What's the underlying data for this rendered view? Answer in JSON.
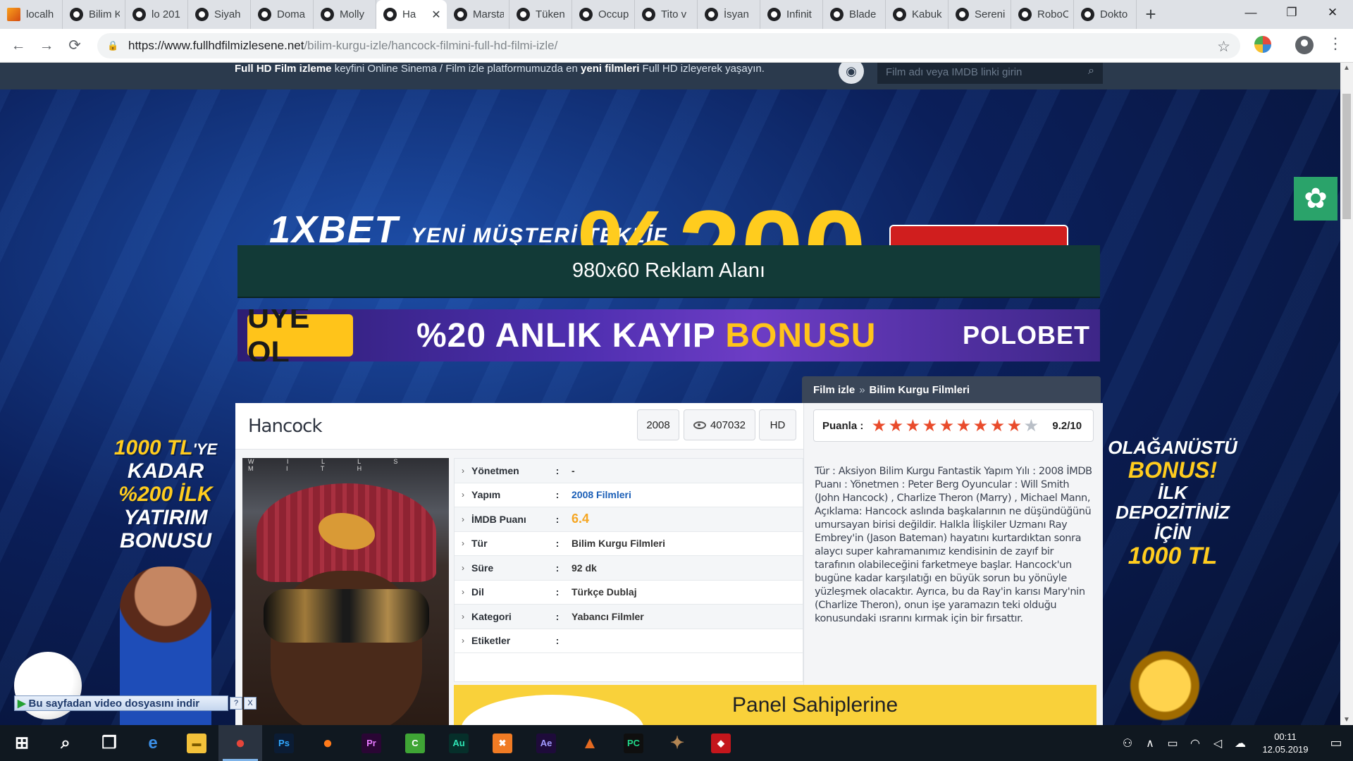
{
  "browser": {
    "tabs": [
      {
        "label": "localh",
        "icon": "phpmyadmin-icon"
      },
      {
        "label": "Bilim K",
        "icon": "film-reel-icon"
      },
      {
        "label": "lo 201",
        "icon": "film-reel-icon"
      },
      {
        "label": "Siyah",
        "icon": "film-reel-icon"
      },
      {
        "label": "Doma",
        "icon": "film-reel-icon"
      },
      {
        "label": "Molly",
        "icon": "film-reel-icon"
      },
      {
        "label": "Ha",
        "icon": "film-reel-icon",
        "active": true
      },
      {
        "label": "Marsta",
        "icon": "film-reel-icon"
      },
      {
        "label": "Tüken",
        "icon": "film-reel-icon"
      },
      {
        "label": "Occup",
        "icon": "film-reel-icon"
      },
      {
        "label": "Tito v",
        "icon": "film-reel-icon"
      },
      {
        "label": "İsyan",
        "icon": "film-reel-icon"
      },
      {
        "label": "Infinit",
        "icon": "film-reel-icon"
      },
      {
        "label": "Blade",
        "icon": "film-reel-icon"
      },
      {
        "label": "Kabuk",
        "icon": "film-reel-icon"
      },
      {
        "label": "Sereni",
        "icon": "film-reel-icon"
      },
      {
        "label": "RoboC",
        "icon": "film-reel-icon"
      },
      {
        "label": "Dokto",
        "icon": "film-reel-icon"
      }
    ],
    "new_tab": "+",
    "window_controls": {
      "minimize": "—",
      "maximize": "❐",
      "close": "✕"
    },
    "nav": {
      "back": "←",
      "forward": "→",
      "reload": "⟳"
    },
    "url_host": "https://www.fullhdfilmizlesene.net",
    "url_path": "/bilim-kurgu-izle/hancock-filmini-full-hd-filmi-izle/",
    "bookmark_star": "☆",
    "menu": "⋮"
  },
  "site": {
    "tagline_parts": [
      {
        "text": "Full HD Film izleme",
        "bold": true
      },
      {
        "text": " keyfini Online Sinema / Film izle platformumuzda en ",
        "bold": false
      },
      {
        "text": "yeni filmleri",
        "bold": true
      },
      {
        "text": " Full HD izleyerek yaşayın.",
        "bold": false
      }
    ],
    "search_placeholder": "Film adı veya IMDB linki girin",
    "rss_icon": "rss-icon"
  },
  "ads": {
    "bg_brand": "1XBET",
    "bg_text": "YENİ MÜŞTERİ TEKLİF",
    "bg_number": "%200",
    "reklam_label": "980x60 Reklam Alanı",
    "polo_uye": "ÜYE OL",
    "polo_text_white": "%20 ANLIK KAYIP ",
    "polo_text_yellow": "BONUSU",
    "polo_brand": "POLOBET",
    "left_line1": "1000 TL",
    "left_line1b": "'YE",
    "left_line2": "KADAR",
    "left_line3": "%200 İLK",
    "left_line4": "YATIRIM",
    "left_line5": "BONUSU",
    "right_line1": "OLAĞANÜSTÜ",
    "right_line2": "BONUS!",
    "right_line3": "İLK",
    "right_line4": "DEPOZİTİNİZ",
    "right_line5": "İÇİN",
    "right_line6": "1000 TL",
    "bottom_ad": "Panel Sahiplerine"
  },
  "breadcrumb": {
    "home": "Film izle",
    "sep": "»",
    "category": "Bilim Kurgu Filmleri"
  },
  "movie": {
    "title": "Hancock",
    "year": "2008",
    "views": "407032",
    "quality": "HD",
    "rating_label": "Puanla :",
    "rating_value": "9.2/10",
    "stars_filled": 9,
    "stars_total": 10,
    "poster_text": "W I L L  S M I T H",
    "details": [
      {
        "key": "Yönetmen",
        "value": "-",
        "style": "plain"
      },
      {
        "key": "Yapım",
        "value": "2008 Filmleri",
        "style": "link"
      },
      {
        "key": "İMDB Puanı",
        "value": "6.4",
        "style": "imdb"
      },
      {
        "key": "Tür",
        "value": "Bilim Kurgu Filmleri",
        "style": "plain"
      },
      {
        "key": "Süre",
        "value": "92 dk",
        "style": "plain"
      },
      {
        "key": "Dil",
        "value": "Türkçe Dublaj",
        "style": "plain"
      },
      {
        "key": "Kategori",
        "value": "Yabancı Filmler",
        "style": "plain"
      },
      {
        "key": "Etiketler",
        "value": "",
        "style": "plain"
      }
    ],
    "separator": ":",
    "description": "Tür : Aksiyon Bilim Kurgu Fantastik Yapım Yılı : 2008 İMDB Puanı : Yönetmen : Peter Berg Oyuncular : Will Smith (John Hancock) , Charlize Theron (Marry) , Michael Mann, Açıklama: Hancock aslında başkalarının ne düşündüğünü umursayan birisi değildir. Halkla İlişkiler Uzmanı Ray Embrey'in (Jason Bateman) hayatını kurtardıktan sonra alaycı super kahramanımız kendisinin de zayıf bir tarafının olabileceğini farketmeye başlar. Hancock'un bugüne kadar karşılatığı en büyük sorun bu yönüyle yüzleşmek olacaktır. Ayrıca, bu da Ray'in karısı Mary'nin (Charlize Theron), onun işe yaramazın teki olduğu konusundaki ısrarını kırmak için bir fırsattır."
  },
  "download_bar": {
    "label": "Bu sayfadan video dosyasını indir",
    "help": "?",
    "close": "X"
  },
  "taskbar": {
    "apps": [
      {
        "name": "start",
        "glyph": "⊞",
        "bg": "transparent",
        "color": "#ffffff"
      },
      {
        "name": "search",
        "glyph": "⌕",
        "bg": "transparent",
        "color": "#ffffff"
      },
      {
        "name": "task-view",
        "glyph": "❒",
        "bg": "transparent",
        "color": "#ffffff"
      },
      {
        "name": "edge",
        "glyph": "e",
        "bg": "transparent",
        "color": "#3c8fe6"
      },
      {
        "name": "file-explorer",
        "glyph": "▬",
        "bg": "#f3c13a",
        "color": "#7a5a00"
      },
      {
        "name": "chrome",
        "glyph": "●",
        "bg": "transparent",
        "color": "#e5453a",
        "active": true
      },
      {
        "name": "photoshop",
        "glyph": "Ps",
        "bg": "#0b1c34",
        "color": "#31a8ff"
      },
      {
        "name": "firefox",
        "glyph": "●",
        "bg": "transparent",
        "color": "#ff7a1a"
      },
      {
        "name": "premiere",
        "glyph": "Pr",
        "bg": "#2a0634",
        "color": "#e77bff"
      },
      {
        "name": "camtasia",
        "glyph": "C",
        "bg": "#3fa535",
        "color": "#ffffff"
      },
      {
        "name": "audition",
        "glyph": "Au",
        "bg": "#062f2a",
        "color": "#2fe6b5"
      },
      {
        "name": "xampp",
        "glyph": "✖",
        "bg": "#f07b24",
        "color": "#ffffff"
      },
      {
        "name": "after-effects",
        "glyph": "Ae",
        "bg": "#1e0b3a",
        "color": "#a39bff"
      },
      {
        "name": "matlab",
        "glyph": "▲",
        "bg": "transparent",
        "color": "#e46a21"
      },
      {
        "name": "pycharm",
        "glyph": "PC",
        "bg": "#0f0f0f",
        "color": "#21d789"
      },
      {
        "name": "game",
        "glyph": "✦",
        "bg": "transparent",
        "color": "#b38553"
      },
      {
        "name": "acrobat",
        "glyph": "◆",
        "bg": "#c4161c",
        "color": "#ffffff"
      }
    ],
    "time": "00:11",
    "date": "12.05.2019"
  }
}
